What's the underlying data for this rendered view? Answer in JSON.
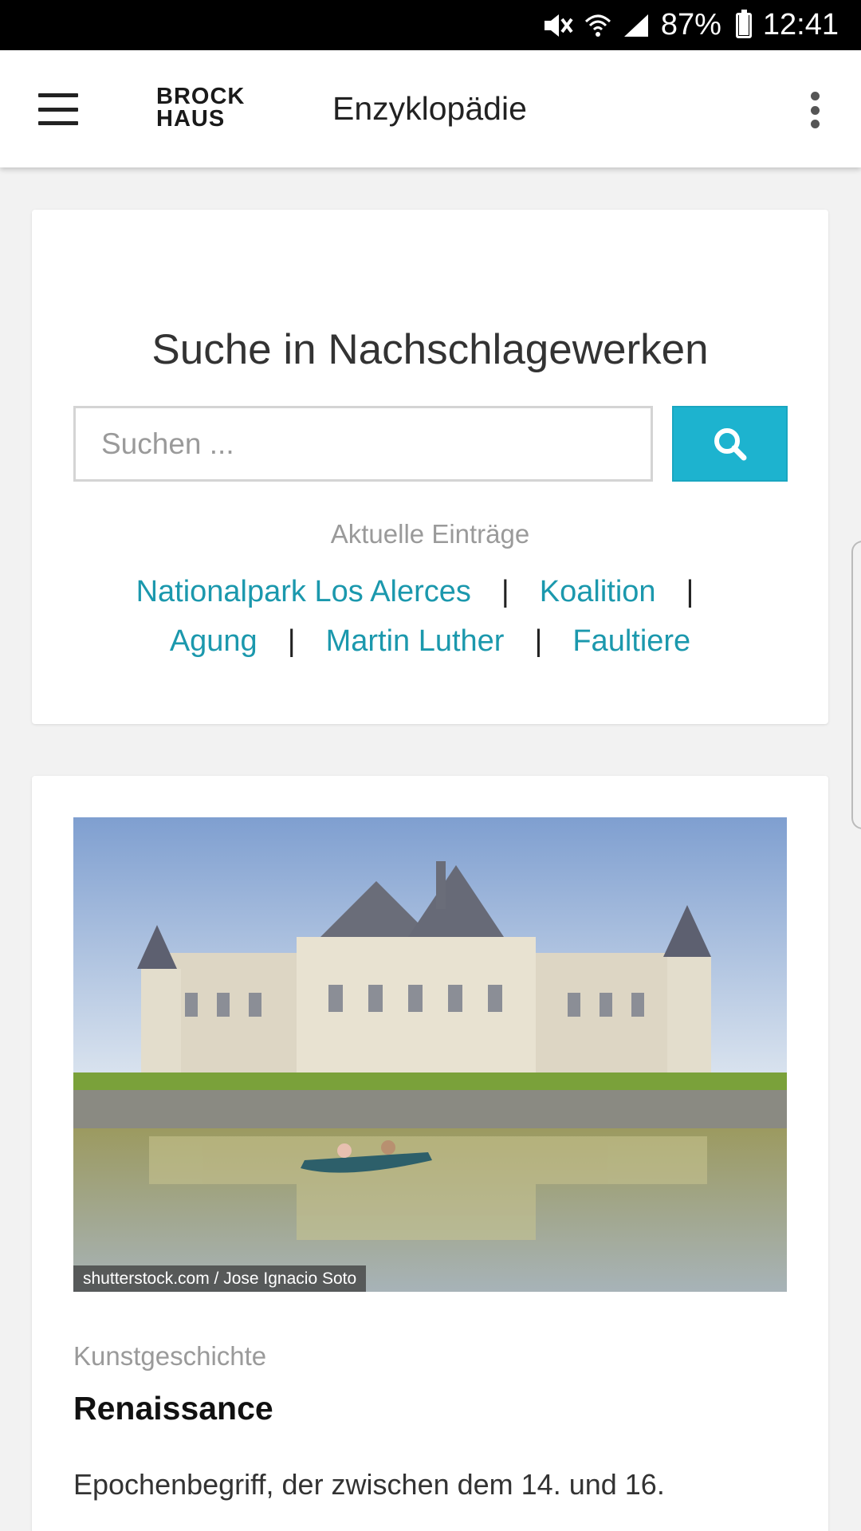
{
  "status_bar": {
    "battery": "87%",
    "time": "12:41",
    "icons": [
      "mute-icon",
      "wifi-icon",
      "signal-icon",
      "battery-icon"
    ]
  },
  "app_bar": {
    "logo_line1": "BROCK",
    "logo_line2": "HAUS",
    "title": "Enzyklopädie",
    "icons": [
      "menu-icon",
      "overflow-icon"
    ]
  },
  "search": {
    "title": "Suche in Nachschlagewerken",
    "placeholder": "Suchen ...",
    "value": "",
    "button_icon": "search-icon",
    "recent_label": "Aktuelle Einträge",
    "recent_entries": [
      "Nationalpark Los Alerces",
      "Koalition",
      "Agung",
      "Martin Luther",
      "Faultiere"
    ],
    "separator": "|"
  },
  "article": {
    "image_credit": "shutterstock.com / Jose Ignacio Soto",
    "category": "Kunstgeschichte",
    "title": "Renaissance",
    "excerpt": "Epochenbegriff, der zwischen dem 14. und 16."
  },
  "colors": {
    "accent": "#1db3cf",
    "link": "#1b98ad",
    "background": "#f2f2f2"
  }
}
